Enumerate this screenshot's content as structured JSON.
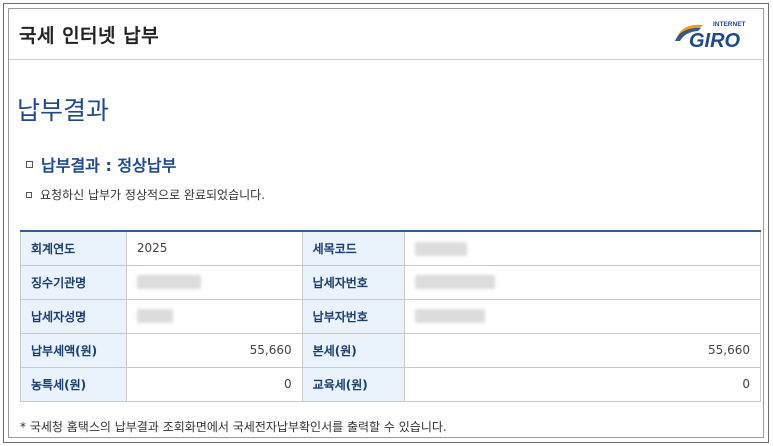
{
  "header": {
    "title": "국세 인터넷 납부",
    "logo_small": "INTERNET",
    "logo_main": "GIRO"
  },
  "page": {
    "heading": "납부결과",
    "result_title": "납부결과 : 정상납부",
    "result_message": "요청하신 납부가 정상적으로 완료되었습니다."
  },
  "table": {
    "rows": [
      {
        "label1": "회계연도",
        "value1": "2025",
        "label2": "세목코드",
        "value2": ""
      },
      {
        "label1": "징수기관명",
        "value1": "",
        "label2": "납세자번호",
        "value2": ""
      },
      {
        "label1": "납세자성명",
        "value1": "",
        "label2": "납부자번호",
        "value2": ""
      },
      {
        "label1": "납부세액(원)",
        "value1": "55,660",
        "label2": "본세(원)",
        "value2": "55,660"
      },
      {
        "label1": "농특세(원)",
        "value1": "0",
        "label2": "교육세(원)",
        "value2": "0"
      }
    ]
  },
  "footer": {
    "note": "* 국세청 홈택스의 납부결과 조회화면에서 국세전자납부확인서를 출력할 수 있습니다."
  },
  "colors": {
    "accent": "#1e4a8c",
    "label_bg": "#eaf2fb",
    "table_top_border": "#2f5d9a"
  }
}
